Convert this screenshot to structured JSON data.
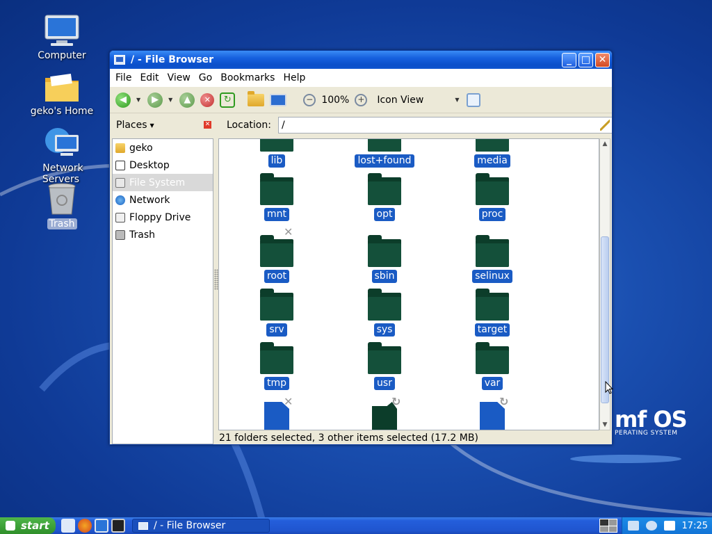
{
  "desktop": {
    "icons": [
      {
        "label": "Computer"
      },
      {
        "label": "geko's Home"
      },
      {
        "label": "Network Servers"
      },
      {
        "label": "Trash"
      }
    ],
    "brand": {
      "big": "mf OS",
      "small": "PERATING SYSTEM"
    }
  },
  "window": {
    "title": "/ - File Browser",
    "controls": {
      "minimize": "_",
      "maximize": "□",
      "close": "✕"
    },
    "menu": [
      "File",
      "Edit",
      "View",
      "Go",
      "Bookmarks",
      "Help"
    ],
    "toolbar": {
      "zoom": "100%",
      "view_mode": "Icon View"
    },
    "places_label": "Places",
    "location_label": "Location:",
    "location_value": "/",
    "sidebar": [
      {
        "label": "geko",
        "icon": "home-folder-icon"
      },
      {
        "label": "Desktop",
        "icon": "desktop-icon"
      },
      {
        "label": "File System",
        "icon": "drive-icon",
        "selected": true
      },
      {
        "label": "Network",
        "icon": "network-icon"
      },
      {
        "label": "Floppy Drive",
        "icon": "floppy-icon"
      },
      {
        "label": "Trash",
        "icon": "trash-icon"
      }
    ],
    "items": [
      {
        "name": "lib"
      },
      {
        "name": "lost+found"
      },
      {
        "name": "media"
      },
      {
        "name": "mnt"
      },
      {
        "name": "opt"
      },
      {
        "name": "proc"
      },
      {
        "name": "root"
      },
      {
        "name": "sbin"
      },
      {
        "name": "selinux"
      },
      {
        "name": "srv"
      },
      {
        "name": "sys"
      },
      {
        "name": "target"
      },
      {
        "name": "tmp"
      },
      {
        "name": "usr"
      },
      {
        "name": "var"
      }
    ],
    "status": "21 folders selected, 3 other items selected (17.2 MB)"
  },
  "taskbar": {
    "start_label": "start",
    "task_label": "/ - File Browser",
    "clock": "17:25"
  }
}
